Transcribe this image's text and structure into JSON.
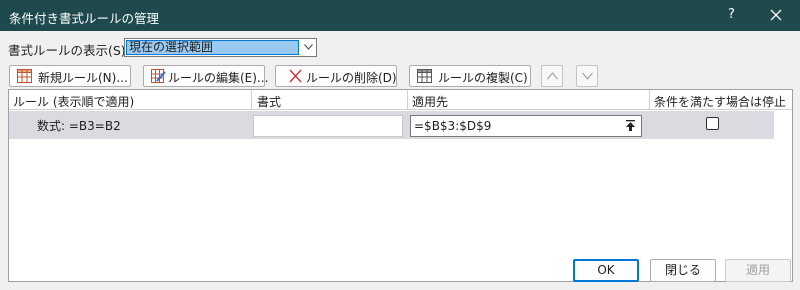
{
  "window": {
    "title": "条件付き書式ルールの管理",
    "help": "?"
  },
  "show_rules": {
    "label": "書式ルールの表示(S):",
    "selected": "現在の選択範囲"
  },
  "toolbar": {
    "new_rule": "新規ルール(N)...",
    "edit_rule": "ルールの編集(E)...",
    "delete_rule": "ルールの削除(D)",
    "duplicate_rule": "ルールの複製(C)"
  },
  "table": {
    "headers": {
      "rule": "ルール (表示順で適用)",
      "format": "書式",
      "applies_to": "適用先",
      "stop_if_true": "条件を満たす場合は停止"
    },
    "rows": [
      {
        "rule": "数式: =B3=B2",
        "format": "",
        "applies_to": "=$B$3:$D$9",
        "stop_if_true": false
      }
    ]
  },
  "buttons": {
    "ok": "OK",
    "close": "閉じる",
    "apply": "適用"
  },
  "colors": {
    "titlebar": "#1e4a4d",
    "selection": "#99c9ef",
    "accent": "#0078d7"
  }
}
